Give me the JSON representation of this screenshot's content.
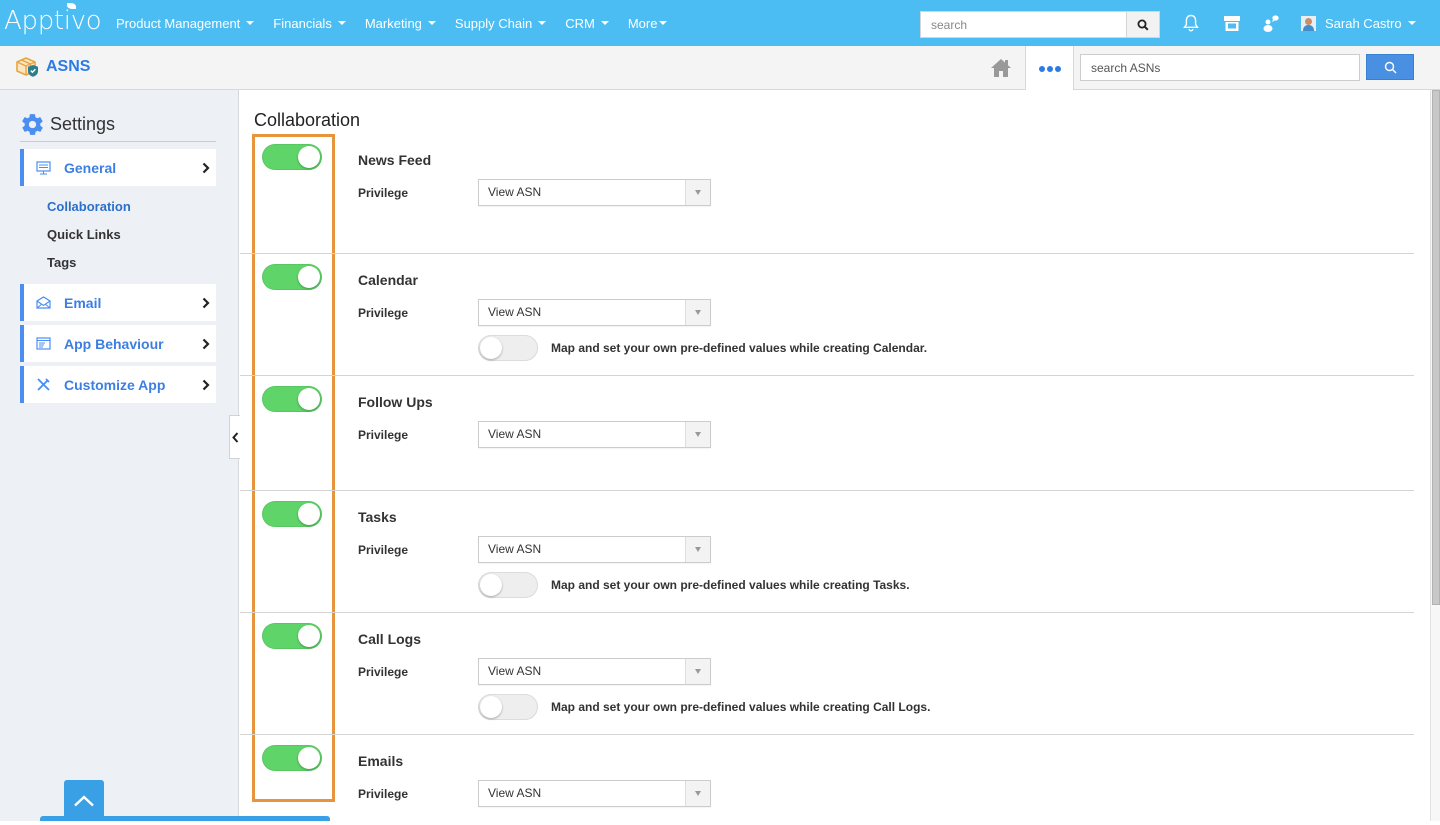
{
  "topbar": {
    "logo": "Apptivo",
    "nav": [
      {
        "label": "Product Management"
      },
      {
        "label": "Financials"
      },
      {
        "label": "Marketing"
      },
      {
        "label": "Supply Chain"
      },
      {
        "label": "CRM"
      },
      {
        "label": "More"
      }
    ],
    "search_placeholder": "search",
    "icons": [
      "bell-icon",
      "store-icon",
      "chat-users-icon"
    ],
    "user_name": "Sarah Castro"
  },
  "subbar": {
    "app_name": "ASNS",
    "search_placeholder": "search ASNs"
  },
  "sidebar": {
    "title": "Settings",
    "sections": [
      {
        "label": "General",
        "icon": "monitor-icon",
        "expanded": true,
        "children": [
          {
            "label": "Collaboration",
            "active": true
          },
          {
            "label": "Quick Links",
            "active": false
          },
          {
            "label": "Tags",
            "active": false
          }
        ]
      },
      {
        "label": "Email",
        "icon": "envelope-icon"
      },
      {
        "label": "App Behaviour",
        "icon": "window-icon"
      },
      {
        "label": "Customize App",
        "icon": "tools-icon"
      }
    ]
  },
  "main": {
    "title": "Collaboration",
    "privilege_label": "Privilege",
    "rows": [
      {
        "name": "News Feed",
        "enabled": true,
        "privilege": "View ASN",
        "map_text": null,
        "map_enabled": null
      },
      {
        "name": "Calendar",
        "enabled": true,
        "privilege": "View ASN",
        "map_text": "Map and set your own pre-defined values while creating Calendar.",
        "map_enabled": false
      },
      {
        "name": "Follow Ups",
        "enabled": true,
        "privilege": "View ASN",
        "map_text": null,
        "map_enabled": null
      },
      {
        "name": "Tasks",
        "enabled": true,
        "privilege": "View ASN",
        "map_text": "Map and set your own pre-defined values while creating Tasks.",
        "map_enabled": false
      },
      {
        "name": "Call Logs",
        "enabled": true,
        "privilege": "View ASN",
        "map_text": "Map and set your own pre-defined values while creating Call Logs.",
        "map_enabled": false
      },
      {
        "name": "Emails",
        "enabled": true,
        "privilege": "View ASN",
        "map_text": null,
        "map_enabled": null
      }
    ]
  },
  "colors": {
    "topbar": "#4bbdf3",
    "accent": "#2c7be5",
    "toggle_on": "#5fd468",
    "highlight": "#e6953c"
  }
}
